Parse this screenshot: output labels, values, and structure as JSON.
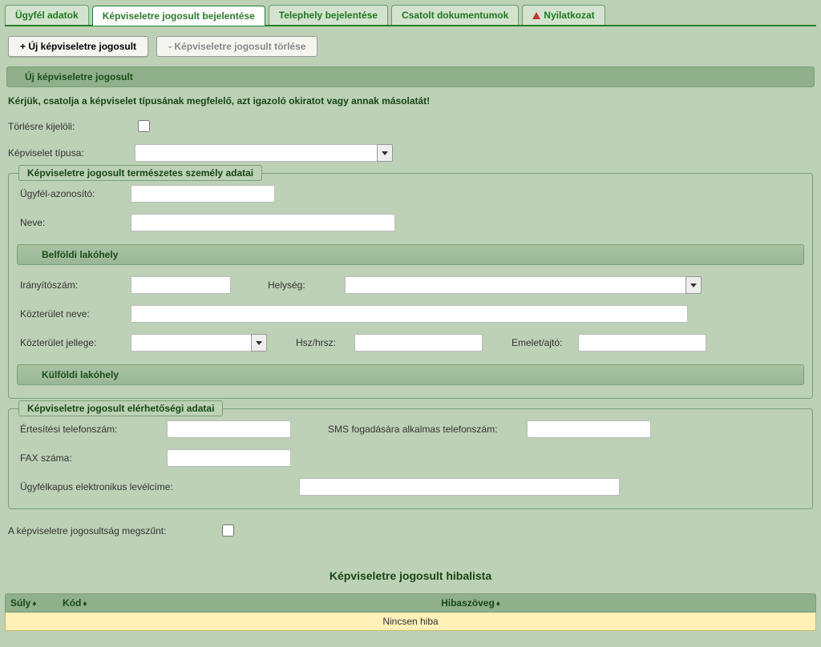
{
  "tabs": {
    "ugyfel": "Ügyfél adatok",
    "kepviselet": "Képviseletre jogosult bejelentése",
    "telephely": "Telephely bejelentése",
    "csatolt": "Csatolt dokumentumok",
    "nyilatkozat": "Nyilatkozat"
  },
  "toolbar": {
    "add": "+ Új képviseletre jogosult",
    "del": "- Képviseletre jogosult törlése"
  },
  "section": {
    "uj": "Új képviseletre jogosult",
    "instruction": "Kérjük, csatolja a képviselet típusának megfelelő, azt igazoló okiratot vagy annak másolatát!",
    "torles_label": "Törlésre kijelöli:",
    "tipus_label": "Képviselet típusa:"
  },
  "szemely": {
    "legend": "Képviseletre jogosult természetes személy adatai",
    "ugyfel_id_label": "Ügyfél-azonosító:",
    "neve_label": "Neve:",
    "belfoldi_bar": "Belföldi lakóhely",
    "iranyito_label": "Irányítószám:",
    "helyseg_label": "Helység:",
    "kozterulet_label": "Közterület neve:",
    "kozterulet_jellege_label": "Közterület jellege:",
    "hsz_label": "Hsz/hrsz:",
    "emelet_label": "Emelet/ajtó:",
    "kulfoldi_bar": "Külföldi lakóhely"
  },
  "elerhetoseg": {
    "legend": "Képviseletre jogosult elérhetőségi adatai",
    "ertesitesi_label": "Értesítési telefonszám:",
    "sms_label": "SMS fogadására alkalmas telefonszám:",
    "fax_label": "FAX száma:",
    "ukapu_label": "Ügyfélkapus elektronikus levélcíme:"
  },
  "megszunt_label": "A képviseletre jogosultság megszűnt:",
  "errlist": {
    "title": "Képviseletre jogosult hibalista",
    "col_suly": "Súly",
    "col_kod": "Kód",
    "col_msg": "Hibaszöveg",
    "empty": "Nincsen hiba"
  }
}
